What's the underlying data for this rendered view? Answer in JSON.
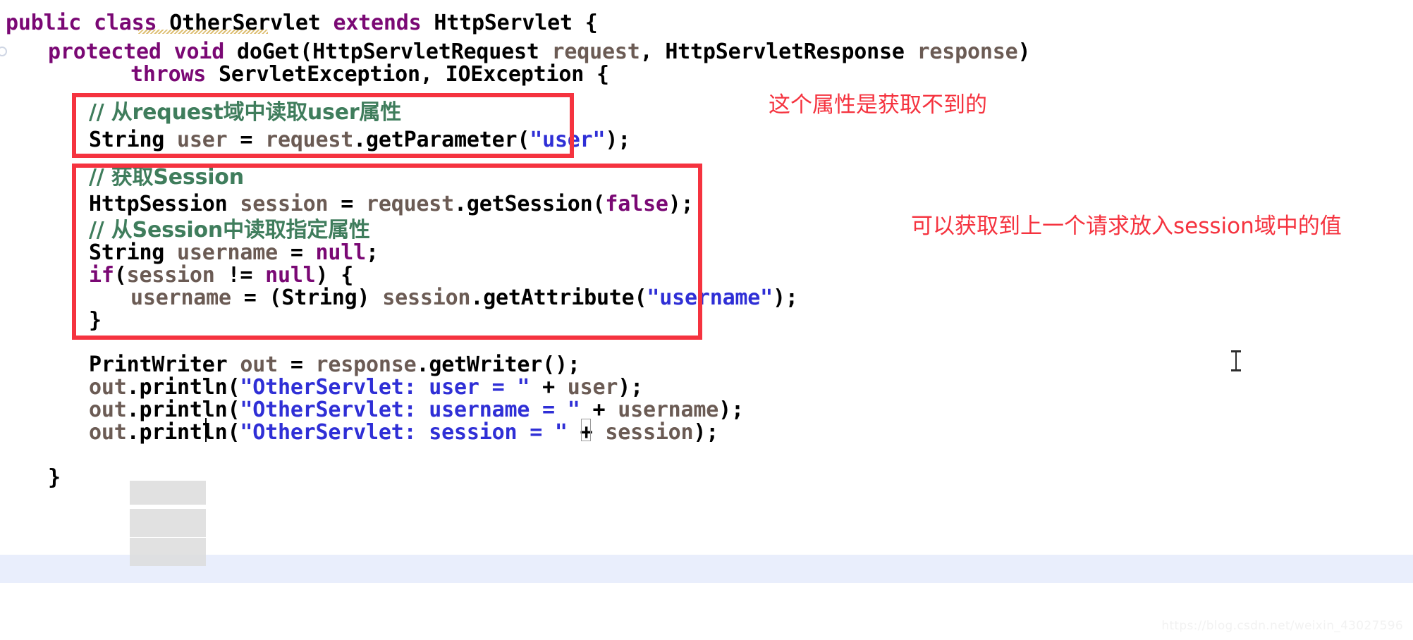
{
  "editor": {
    "language": "java",
    "background_color": "#ffffff",
    "current_line_highlight_color": "#e9eefc",
    "occurrence_highlight_color": "#dcdcdc",
    "annotation_color": "#f5333f",
    "comment_color": "#3f7d5c",
    "keyword_color": "#7a0874",
    "string_color": "#2f2fd6",
    "identifier_color": "#6b5b54"
  },
  "code": {
    "line1": {
      "kw_public": "public",
      "kw_class": "class",
      "name_otherservlet": "OtherServlet",
      "kw_extends": "extends",
      "name_httpservlet": "HttpServlet",
      "brace_open": "{"
    },
    "line2": {
      "kw_protected": "protected",
      "kw_void": "void",
      "method": "doGet",
      "paren_open": "(",
      "type_request": "HttpServletRequest",
      "arg_request": "request",
      "comma": ", ",
      "type_response": "HttpServletResponse",
      "arg_response": "response",
      "paren_close": ")"
    },
    "line3": {
      "kw_throws": "throws",
      "ex_servlet": "ServletException",
      "comma": ", ",
      "ex_io": "IOException",
      "brace_open": "{"
    },
    "line5_comment": "// 从request域中读取user属性",
    "line6": {
      "type": "String",
      "var": "user",
      "eq": " = ",
      "obj": "request",
      "dot": ".",
      "call": "getParameter",
      "paren_open": "(",
      "str": "\"user\"",
      "tail": ");"
    },
    "line8_comment": "// 获取Session",
    "line9": {
      "type": "HttpSession",
      "var": "session",
      "eq": " = ",
      "obj": "request",
      "dot": ".",
      "call": "getSession",
      "paren_open": "(",
      "lit": "false",
      "tail": ");"
    },
    "line10_comment": "// 从Session中读取指定属性",
    "line11": {
      "type": "String",
      "var": "username",
      "eq": " = ",
      "lit": "null",
      "tail": ";"
    },
    "line12": {
      "kw_if": "if",
      "paren_open": "(",
      "var": "session",
      "op": " != ",
      "lit": "null",
      "paren_close": ")",
      "brace_open": " {"
    },
    "line13": {
      "var": "username",
      "eq": " = ",
      "cast": "(String)",
      "obj": " session",
      "dot": ".",
      "call": "getAttribute",
      "paren_open": "(",
      "str": "\"username\"",
      "tail": ");"
    },
    "line14_brace_close": "}",
    "line16": {
      "type": "PrintWriter",
      "var": "out",
      "eq": " = ",
      "obj": "response",
      "dot": ".",
      "call": "getWriter",
      "tail": "();"
    },
    "line17": {
      "obj": "out",
      "dot": ".",
      "call": "println",
      "paren_open": "(",
      "str": "\"OtherServlet: user = \"",
      "plus": " + ",
      "var": "user",
      "tail": ");"
    },
    "line18": {
      "obj": "out",
      "dot": ".",
      "call": "println",
      "paren_open": "(",
      "str": "\"OtherServlet: username = \"",
      "plus": " + ",
      "var": "username",
      "tail": ");"
    },
    "line19": {
      "obj": "out",
      "dot": ".",
      "call": "println",
      "paren_open": "(",
      "str": "\"OtherServlet: session = \"",
      "plus": " + ",
      "var": "session",
      "tail": ");"
    },
    "line21_brace_close": "}"
  },
  "annotations": {
    "request_attr_note": "这个属性是获取不到的",
    "session_attr_note": "可以获取到上一个请求放入session域中的值"
  },
  "watermark": "https://blog.csdn.net/weixin_43027596"
}
